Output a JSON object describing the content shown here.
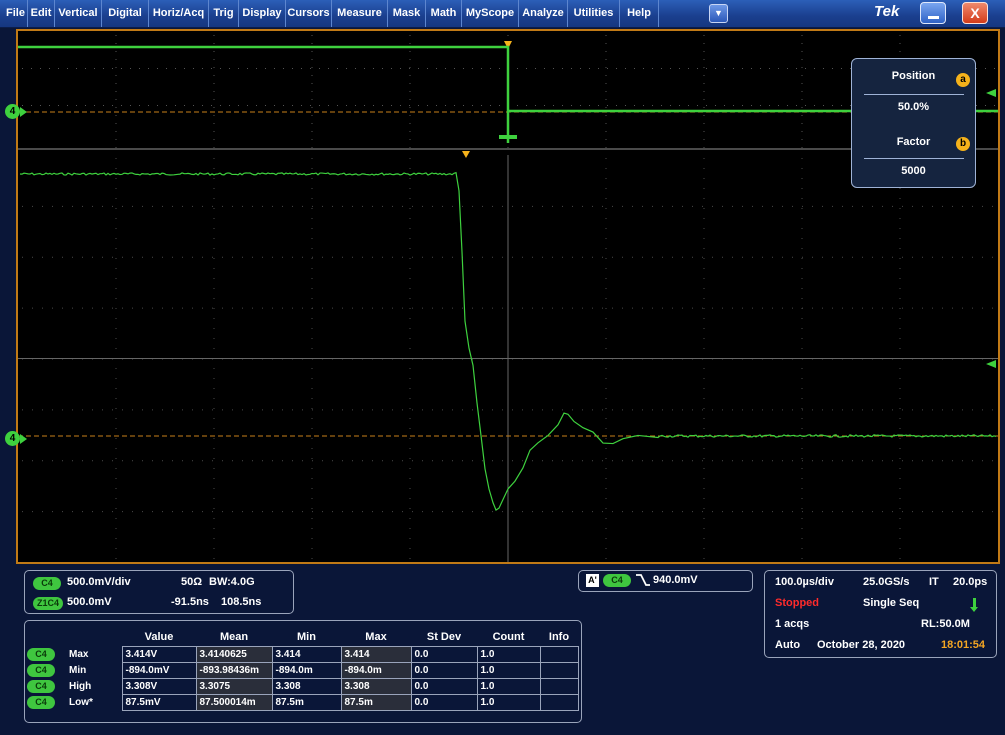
{
  "menu": [
    "File",
    "Edit",
    "Vertical",
    "Digital",
    "Horiz/Acq",
    "Trig",
    "Display",
    "Cursors",
    "Measure",
    "Mask",
    "Math",
    "MyScope",
    "Analyze",
    "Utilities",
    "Help"
  ],
  "brand": "Tek",
  "zoom_panel": {
    "position_label": "Position",
    "position_badge": "a",
    "position_value": "50.0%",
    "factor_label": "Factor",
    "factor_badge": "b",
    "factor_value": "5000"
  },
  "channel_markers": [
    "4",
    "4"
  ],
  "channel": {
    "badge": "C4",
    "scale": "500.0mV/div",
    "impedance": "50Ω",
    "bw": "BW:4.0G"
  },
  "zoom_channel": {
    "badge": "Z1C4",
    "scale": "500.0mV",
    "offset": "-91.5ns",
    "width": "108.5ns"
  },
  "trigger": {
    "a_badge": "A'",
    "badge": "C4",
    "slope_icon": "falling-edge-icon",
    "level": "940.0mV"
  },
  "timebase": {
    "scale": "100.0µs/div",
    "rate": "25.0GS/s",
    "mode": "IT",
    "resolution": "20.0ps",
    "status": "Stopped",
    "acq_mode": "Single Seq",
    "acqs": "1 acqs",
    "record_length": "RL:50.0M",
    "auto": "Auto",
    "date": "October 28, 2020",
    "time": "18:01:54"
  },
  "measurements": {
    "headers": [
      "",
      "",
      "Value",
      "Mean",
      "Min",
      "Max",
      "St Dev",
      "Count",
      "Info"
    ],
    "rows": [
      {
        "badge": "C4",
        "name": "Max",
        "value": "3.414V",
        "mean": "3.4140625",
        "min": "3.414",
        "max": "3.414",
        "stdev": "0.0",
        "count": "1.0",
        "info": ""
      },
      {
        "badge": "C4",
        "name": "Min",
        "value": "-894.0mV",
        "mean": "-893.98436m",
        "min": "-894.0m",
        "max": "-894.0m",
        "stdev": "0.0",
        "count": "1.0",
        "info": ""
      },
      {
        "badge": "C4",
        "name": "High",
        "value": "3.308V",
        "mean": "3.3075",
        "min": "3.308",
        "max": "3.308",
        "stdev": "0.0",
        "count": "1.0",
        "info": ""
      },
      {
        "badge": "C4",
        "name": "Low*",
        "value": "87.5mV",
        "mean": "87.500014m",
        "min": "87.5m",
        "max": "87.5m",
        "stdev": "0.0",
        "count": "1.0",
        "info": ""
      }
    ]
  },
  "colors": {
    "trace": "#3ed13e",
    "marker": "#d08a1a",
    "status_stopped": "#ff2b2b",
    "time": "#f5a623"
  }
}
